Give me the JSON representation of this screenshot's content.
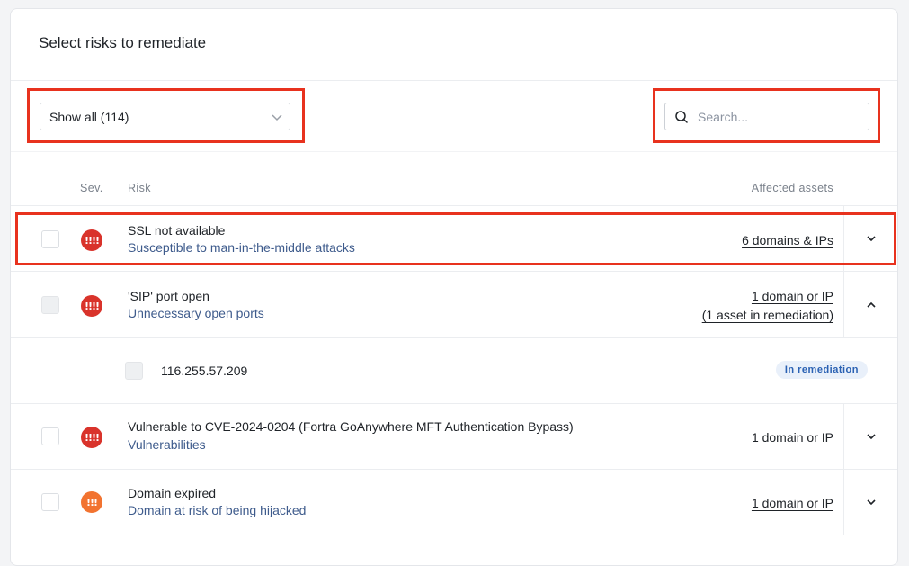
{
  "title": "Select risks to remediate",
  "filter": {
    "value": "Show all (114)"
  },
  "search": {
    "placeholder": "Search..."
  },
  "columns": {
    "severity": "Sev.",
    "risk": "Risk",
    "assets": "Affected assets"
  },
  "rows": [
    {
      "severity": "critical",
      "severity_glyph": "!!!!",
      "title": "SSL not available",
      "subtitle": "Susceptible to man-in-the-middle attacks",
      "assets": "6 domains & IPs",
      "expanded": false
    },
    {
      "severity": "critical",
      "severity_glyph": "!!!!",
      "title": "'SIP' port open",
      "subtitle": "Unnecessary open ports",
      "assets": "1 domain or IP",
      "assets_note": "(1 asset in remediation)",
      "expanded": true,
      "children": [
        {
          "ip": "116.255.57.209",
          "status": "In remediation"
        }
      ]
    },
    {
      "severity": "critical",
      "severity_glyph": "!!!!",
      "title": "Vulnerable to CVE-2024-0204 (Fortra GoAnywhere MFT Authentication Bypass)",
      "subtitle": "Vulnerabilities",
      "assets": "1 domain or IP",
      "expanded": false
    },
    {
      "severity": "high",
      "severity_glyph": "!!!",
      "title": "Domain expired",
      "subtitle": "Domain at risk of being hijacked",
      "assets": "1 domain or IP",
      "expanded": false
    }
  ],
  "colors": {
    "critical": "#d9332b",
    "high": "#f27330",
    "highlight": "#e8321e",
    "link_subtitle": "#3e5b8c",
    "badge_bg": "#e9f0fa",
    "badge_text": "#2a61b3"
  }
}
